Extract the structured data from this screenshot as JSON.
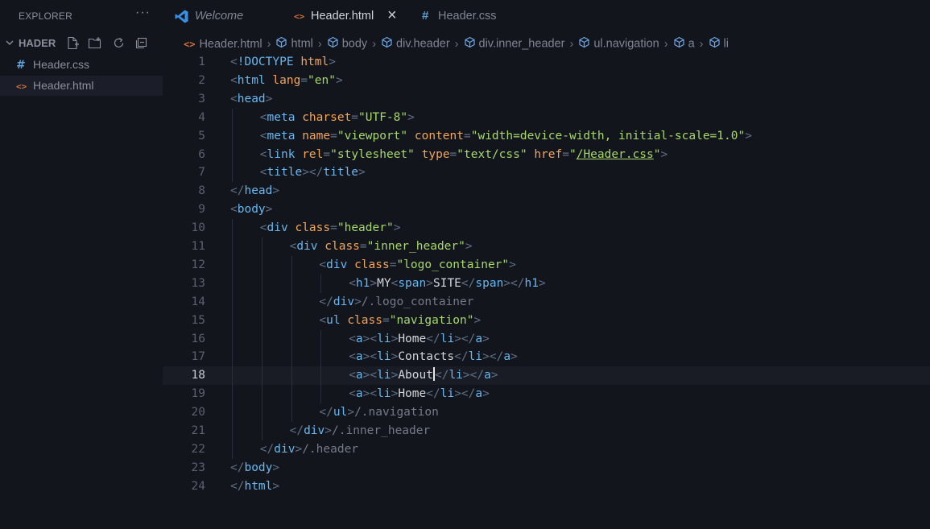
{
  "explorer": {
    "title": "EXPLORER",
    "more": "···",
    "folder": "HADER",
    "files": [
      {
        "name": "Header.css",
        "icon": "#",
        "icon_color": "#5ca0d8",
        "active": false
      },
      {
        "name": "Header.html",
        "icon": "<>",
        "icon_color": "#d0703b",
        "active": true
      }
    ]
  },
  "tabs": [
    {
      "label": "Welcome",
      "icon": "vscode-icon",
      "active": false,
      "italic": true
    },
    {
      "label": "Header.html",
      "icon": "<>",
      "active": true,
      "close": "×"
    },
    {
      "label": "Header.css",
      "icon": "#",
      "active": false
    }
  ],
  "breadcrumb": [
    "Header.html",
    "html",
    "body",
    "div.header",
    "div.inner_header",
    "ul.navigation",
    "a",
    "li"
  ],
  "editor": {
    "current_line": 18,
    "lines": [
      {
        "n": "1",
        "indent": 0,
        "tokens": [
          [
            "p",
            "<"
          ],
          [
            "t",
            "!DOCTYPE"
          ],
          [
            "x",
            " "
          ],
          [
            "a",
            "html"
          ],
          [
            "p",
            ">"
          ]
        ]
      },
      {
        "n": "2",
        "indent": 0,
        "tokens": [
          [
            "p",
            "<"
          ],
          [
            "t",
            "html"
          ],
          [
            "x",
            " "
          ],
          [
            "a",
            "lang"
          ],
          [
            "p",
            "="
          ],
          [
            "s",
            "\"en\""
          ],
          [
            "p",
            ">"
          ]
        ]
      },
      {
        "n": "3",
        "indent": 0,
        "tokens": [
          [
            "p",
            "<"
          ],
          [
            "t",
            "head"
          ],
          [
            "p",
            ">"
          ]
        ]
      },
      {
        "n": "4",
        "indent": 1,
        "tokens": [
          [
            "p",
            "<"
          ],
          [
            "t",
            "meta"
          ],
          [
            "x",
            " "
          ],
          [
            "a",
            "charset"
          ],
          [
            "p",
            "="
          ],
          [
            "s",
            "\"UTF-8\""
          ],
          [
            "p",
            ">"
          ]
        ]
      },
      {
        "n": "5",
        "indent": 1,
        "tokens": [
          [
            "p",
            "<"
          ],
          [
            "t",
            "meta"
          ],
          [
            "x",
            " "
          ],
          [
            "a",
            "name"
          ],
          [
            "p",
            "="
          ],
          [
            "s",
            "\"viewport\""
          ],
          [
            "x",
            " "
          ],
          [
            "a",
            "content"
          ],
          [
            "p",
            "="
          ],
          [
            "s",
            "\"width=device-width, initial-scale=1.0\""
          ],
          [
            "p",
            ">"
          ]
        ]
      },
      {
        "n": "6",
        "indent": 1,
        "tokens": [
          [
            "p",
            "<"
          ],
          [
            "t",
            "link"
          ],
          [
            "x",
            " "
          ],
          [
            "a",
            "rel"
          ],
          [
            "p",
            "="
          ],
          [
            "s",
            "\"stylesheet\""
          ],
          [
            "x",
            " "
          ],
          [
            "a",
            "type"
          ],
          [
            "p",
            "="
          ],
          [
            "s",
            "\"text/css\""
          ],
          [
            "x",
            " "
          ],
          [
            "a",
            "href"
          ],
          [
            "p",
            "="
          ],
          [
            "s",
            "\""
          ],
          [
            "u",
            "/Header.css"
          ],
          [
            "s",
            "\""
          ],
          [
            "p",
            ">"
          ]
        ]
      },
      {
        "n": "7",
        "indent": 1,
        "tokens": [
          [
            "p",
            "<"
          ],
          [
            "t",
            "title"
          ],
          [
            "p",
            "></"
          ],
          [
            "t",
            "title"
          ],
          [
            "p",
            ">"
          ]
        ]
      },
      {
        "n": "8",
        "indent": 0,
        "tokens": [
          [
            "p",
            "</"
          ],
          [
            "t",
            "head"
          ],
          [
            "p",
            ">"
          ]
        ]
      },
      {
        "n": "9",
        "indent": 0,
        "tokens": [
          [
            "p",
            "<"
          ],
          [
            "t",
            "body"
          ],
          [
            "p",
            ">"
          ]
        ]
      },
      {
        "n": "10",
        "indent": 1,
        "tokens": [
          [
            "p",
            "<"
          ],
          [
            "t",
            "div"
          ],
          [
            "x",
            " "
          ],
          [
            "a",
            "class"
          ],
          [
            "p",
            "="
          ],
          [
            "s",
            "\"header\""
          ],
          [
            "p",
            ">"
          ]
        ]
      },
      {
        "n": "11",
        "indent": 2,
        "tokens": [
          [
            "p",
            "<"
          ],
          [
            "t",
            "div"
          ],
          [
            "x",
            " "
          ],
          [
            "a",
            "class"
          ],
          [
            "p",
            "="
          ],
          [
            "s",
            "\"inner_header\""
          ],
          [
            "p",
            ">"
          ]
        ]
      },
      {
        "n": "12",
        "indent": 3,
        "tokens": [
          [
            "p",
            "<"
          ],
          [
            "t",
            "div"
          ],
          [
            "x",
            " "
          ],
          [
            "a",
            "class"
          ],
          [
            "p",
            "="
          ],
          [
            "s",
            "\"logo_container\""
          ],
          [
            "p",
            ">"
          ]
        ]
      },
      {
        "n": "13",
        "indent": 4,
        "tokens": [
          [
            "p",
            "<"
          ],
          [
            "t",
            "h1"
          ],
          [
            "p",
            ">"
          ],
          [
            "x",
            "MY"
          ],
          [
            "p",
            "<"
          ],
          [
            "t",
            "span"
          ],
          [
            "p",
            ">"
          ],
          [
            "x",
            "SITE"
          ],
          [
            "p",
            "</"
          ],
          [
            "t",
            "span"
          ],
          [
            "p",
            "></"
          ],
          [
            "t",
            "h1"
          ],
          [
            "p",
            ">"
          ]
        ]
      },
      {
        "n": "14",
        "indent": 3,
        "tokens": [
          [
            "p",
            "</"
          ],
          [
            "t",
            "div"
          ],
          [
            "p",
            ">"
          ],
          [
            "c",
            "/.logo_container"
          ]
        ]
      },
      {
        "n": "15",
        "indent": 3,
        "tokens": [
          [
            "p",
            "<"
          ],
          [
            "t",
            "ul"
          ],
          [
            "x",
            " "
          ],
          [
            "a",
            "class"
          ],
          [
            "p",
            "="
          ],
          [
            "s",
            "\"navigation\""
          ],
          [
            "p",
            ">"
          ]
        ]
      },
      {
        "n": "16",
        "indent": 4,
        "tokens": [
          [
            "p",
            "<"
          ],
          [
            "t",
            "a"
          ],
          [
            "p",
            "><"
          ],
          [
            "t",
            "li"
          ],
          [
            "p",
            ">"
          ],
          [
            "x",
            "Home"
          ],
          [
            "p",
            "</"
          ],
          [
            "t",
            "li"
          ],
          [
            "p",
            "></"
          ],
          [
            "t",
            "a"
          ],
          [
            "p",
            ">"
          ]
        ]
      },
      {
        "n": "17",
        "indent": 4,
        "tokens": [
          [
            "p",
            "<"
          ],
          [
            "t",
            "a"
          ],
          [
            "p",
            "><"
          ],
          [
            "t",
            "li"
          ],
          [
            "p",
            ">"
          ],
          [
            "x",
            "Contacts"
          ],
          [
            "p",
            "</"
          ],
          [
            "t",
            "li"
          ],
          [
            "p",
            "></"
          ],
          [
            "t",
            "a"
          ],
          [
            "p",
            ">"
          ]
        ]
      },
      {
        "n": "18",
        "indent": 4,
        "tokens": [
          [
            "p",
            "<"
          ],
          [
            "t",
            "a"
          ],
          [
            "p",
            "><"
          ],
          [
            "t",
            "li"
          ],
          [
            "p",
            ">"
          ],
          [
            "x",
            "About"
          ],
          [
            "k",
            ""
          ],
          [
            "p",
            "</"
          ],
          [
            "t",
            "li"
          ],
          [
            "p",
            "></"
          ],
          [
            "t",
            "a"
          ],
          [
            "p",
            ">"
          ]
        ]
      },
      {
        "n": "19",
        "indent": 4,
        "tokens": [
          [
            "p",
            "<"
          ],
          [
            "t",
            "a"
          ],
          [
            "p",
            "><"
          ],
          [
            "t",
            "li"
          ],
          [
            "p",
            ">"
          ],
          [
            "x",
            "Home"
          ],
          [
            "p",
            "</"
          ],
          [
            "t",
            "li"
          ],
          [
            "p",
            "></"
          ],
          [
            "t",
            "a"
          ],
          [
            "p",
            ">"
          ]
        ]
      },
      {
        "n": "20",
        "indent": 3,
        "tokens": [
          [
            "p",
            "</"
          ],
          [
            "t",
            "ul"
          ],
          [
            "p",
            ">"
          ],
          [
            "c",
            "/.navigation"
          ]
        ]
      },
      {
        "n": "21",
        "indent": 2,
        "tokens": [
          [
            "p",
            "</"
          ],
          [
            "t",
            "div"
          ],
          [
            "p",
            ">"
          ],
          [
            "c",
            "/.inner_header"
          ]
        ]
      },
      {
        "n": "22",
        "indent": 1,
        "tokens": [
          [
            "p",
            "</"
          ],
          [
            "t",
            "div"
          ],
          [
            "p",
            ">"
          ],
          [
            "c",
            "/.header"
          ]
        ]
      },
      {
        "n": "23",
        "indent": 0,
        "tokens": [
          [
            "p",
            "</"
          ],
          [
            "t",
            "body"
          ],
          [
            "p",
            ">"
          ]
        ]
      },
      {
        "n": "24",
        "indent": 0,
        "tokens": [
          [
            "p",
            "</"
          ],
          [
            "t",
            "html"
          ],
          [
            "p",
            ">"
          ]
        ]
      }
    ]
  },
  "colors": {
    "background": "#13151c",
    "tag": "#67b7f0",
    "attribute": "#f2a65a",
    "string": "#a6d86a",
    "html_icon": "#d0703b",
    "css_icon": "#5ca0d8",
    "vscode_icon": "#3a8fe0"
  }
}
